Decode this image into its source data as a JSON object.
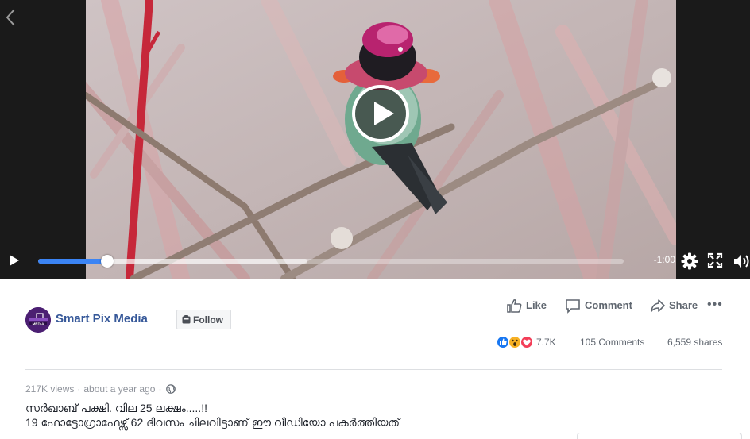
{
  "video": {
    "time_remaining": "-1:00",
    "progress_fraction": 0.118,
    "buffered_fraction": 0.46
  },
  "page": {
    "name": "Smart Pix Media",
    "avatar_text": "SMART PIX MEDIA",
    "follow_label": "Follow"
  },
  "actions": {
    "like_label": "Like",
    "comment_label": "Comment",
    "share_label": "Share",
    "more_label": "•••"
  },
  "stats": {
    "reactions_count": "7.7K",
    "comments": "105 Comments",
    "shares": "6,559 shares"
  },
  "post": {
    "views": "217K views",
    "separator": "·",
    "time": "about a year ago",
    "caption_line1": "സർഖാബ് പക്ഷി. വില 25 ലക്ഷം.....!!",
    "caption_line2": "19 ഫോട്ടോഗ്രാഫേഴ്സ് 62 ദിവസം ചിലവിട്ടാണ് ഈ വീഡിയോ പകർത്തിയത്"
  },
  "colors": {
    "link_blue": "#365899",
    "progress_blue": "#3b84f4",
    "like_blue": "#1877f2",
    "love_red": "#f33e58",
    "wow_yellow": "#f7b125"
  },
  "icons": [
    "back-chevron-icon",
    "play-icon",
    "settings-gear-icon",
    "fullscreen-icon",
    "volume-icon",
    "thumbs-up-icon",
    "comment-bubble-icon",
    "share-arrow-icon",
    "globe-icon"
  ]
}
